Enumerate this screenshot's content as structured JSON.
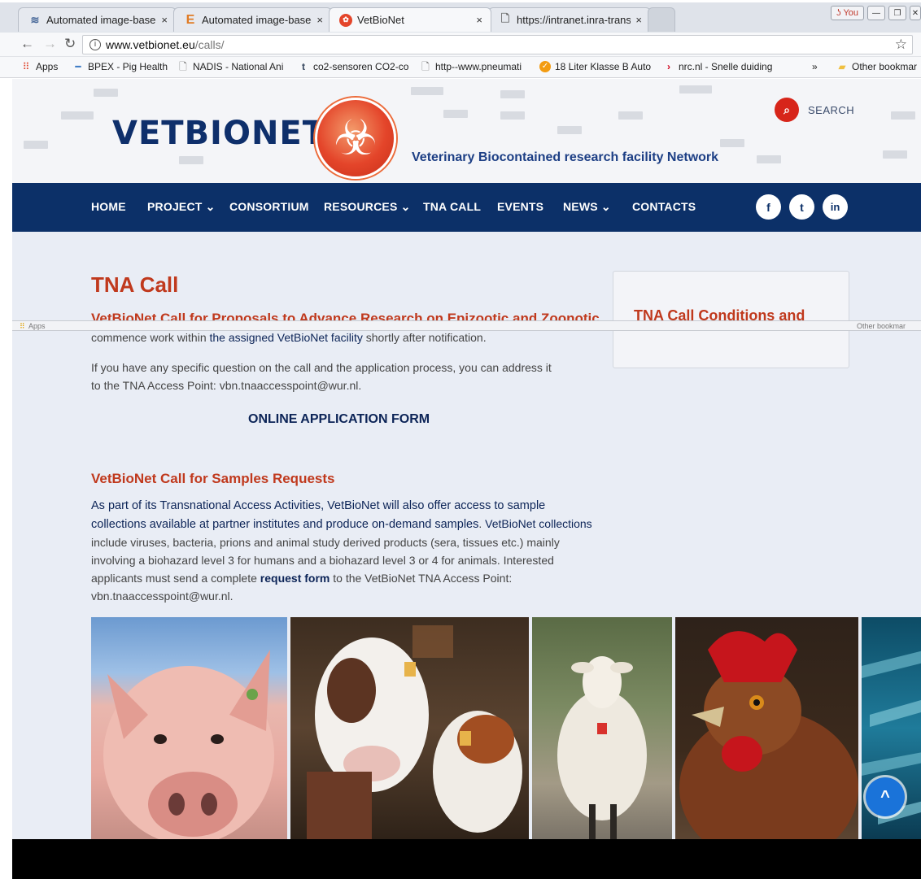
{
  "tabs": [
    {
      "label": "Automated image-based",
      "close": "×"
    },
    {
      "label": "Automated image-based",
      "close": "×"
    },
    {
      "label": "VetBioNet",
      "close": "×"
    },
    {
      "label": "https://intranet.inra-trans",
      "close": "×"
    }
  ],
  "window": {
    "user_label": "You"
  },
  "address": {
    "host": "www.vetbionet.eu",
    "path": "/calls/"
  },
  "bookmarks": [
    "Apps",
    "BPEX - Pig Health",
    "NADIS - National Ani",
    "co2-sensoren CO2-co",
    "http--www.pneumati",
    "18 Liter Klasse B Auto",
    "nrc.nl - Snelle duiding",
    "»",
    "Other bookmar"
  ],
  "site": {
    "logo_text": "VETBIONET",
    "tagline": "Veterinary Biocontained research facility Network",
    "search_label": "SEARCH",
    "nav": [
      "HOME",
      "PROJECT ⌄",
      "CONSORTIUM",
      "RESOURCES ⌄",
      "TNA CALL",
      "EVENTS",
      "NEWS ⌄",
      "CONTACTS"
    ],
    "social": [
      "f",
      "t",
      "in"
    ],
    "page_title": "TNA Call",
    "call_heading": "VetBioNet Call for Proposals to Advance Research on Epizootic and Zoonotic",
    "sidebar_title": "TNA Call Conditions and",
    "para1_a": "commence work within ",
    "para1_link": "the assigned VetBioNet facility",
    "para1_b": " shortly after notification.",
    "para2": "If you have any specific question on the call and the application process, you can address it to the TNA Access Point: vbn.tnaaccesspoint@wur.nl.",
    "online_form": "ONLINE APPLICATION FORM",
    "samples_heading": "VetBioNet Call for Samples Requests",
    "samples_lead": "As part of its Transnational Access Activities, VetBioNet will also offer access to sample collections available at partner institutes and produce on-demand samples",
    "samples_dot": ". ",
    "samples_link": "VetBioNet collections",
    "samples_body": " include viruses, bacteria, prions and animal study derived products (sera, tissues etc.) mainly involving a biohazard level 3 for humans and a biohazard level 3 or 4 for animals. Interested applicants must send a complete ",
    "samples_req": "request form",
    "samples_tail": " to the VetBioNet TNA Access Point: vbn.tnaaccesspoint@wur.nl.",
    "scroll_top": "^"
  },
  "colors": {
    "brand_navy": "#0c3068",
    "accent_red": "#c0391d",
    "search_red": "#d7251a",
    "scroll_blue": "#1a73d9"
  }
}
